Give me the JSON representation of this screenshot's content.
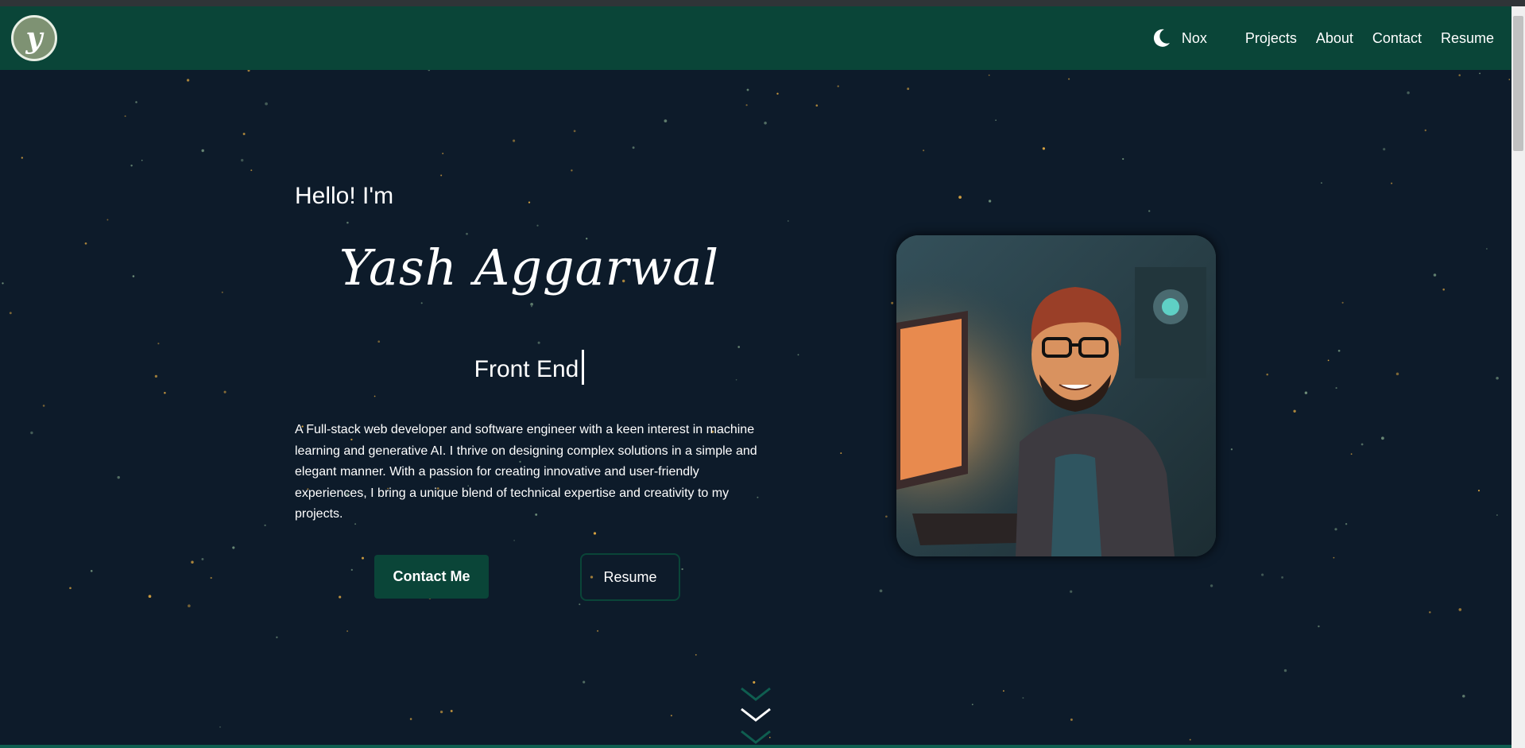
{
  "navbar": {
    "logo_letter": "y",
    "theme_label": "Nox",
    "links": [
      "Projects",
      "About",
      "Contact",
      "Resume"
    ]
  },
  "hero": {
    "greeting": "Hello! I'm",
    "name": "Yash Aggarwal",
    "role": "Front End",
    "description": "A Full-stack web developer and software engineer with a keen interest in machine learning and generative AI. I thrive on designing complex solutions in a simple and elegant manner. With a passion for creating innovative and user-friendly experiences, I bring a unique blend of technical expertise and creativity to my projects.",
    "contact_button": "Contact Me",
    "resume_button": "Resume"
  },
  "icons": {
    "theme": "moon-icon",
    "scroll": "chevron-down-icon"
  },
  "colors": {
    "background": "#0d1b2a",
    "navbar": "#0a4538",
    "accent": "#0f5e50",
    "star": "#d9a441"
  }
}
